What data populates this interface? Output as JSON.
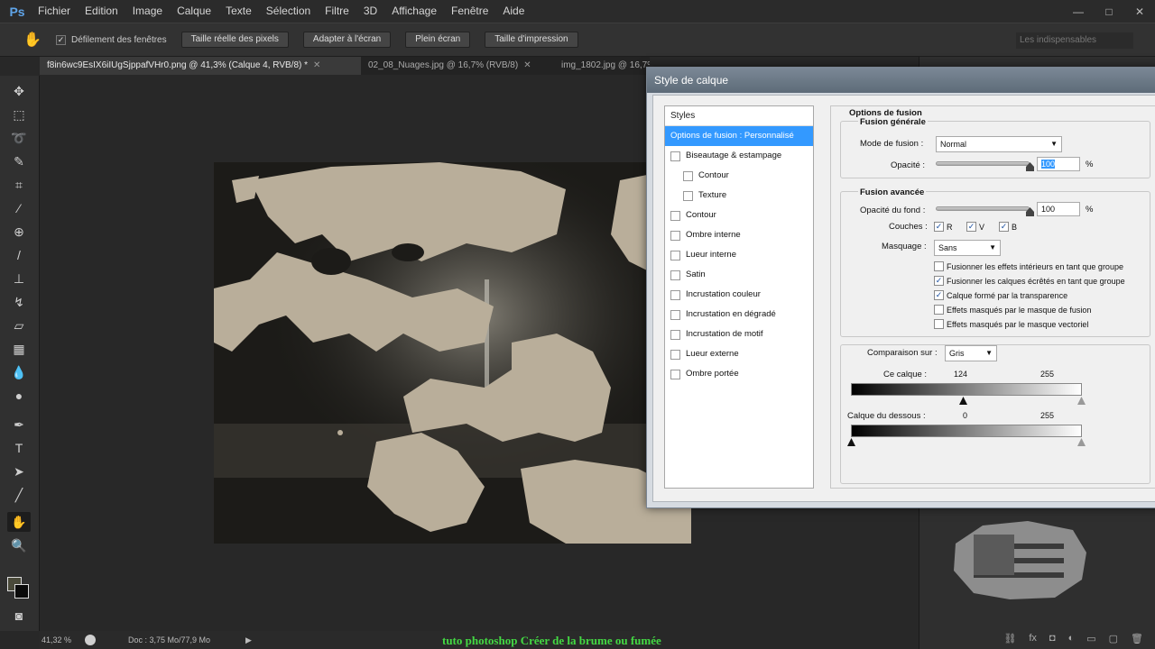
{
  "app": {
    "logo": "Ps"
  },
  "menu": [
    "Fichier",
    "Edition",
    "Image",
    "Calque",
    "Texte",
    "Sélection",
    "Filtre",
    "3D",
    "Affichage",
    "Fenêtre",
    "Aide"
  ],
  "window_controls": {
    "minimize": "—",
    "maximize": "□",
    "close": "✕"
  },
  "options_bar": {
    "scroll_all_label": "Défilement des fenêtres",
    "buttons": [
      "Taille réelle des pixels",
      "Adapter à l'écran",
      "Plein écran",
      "Taille d'impression"
    ],
    "workspace": "Les indispensables"
  },
  "tabs": [
    {
      "label": "f8in6wc9EsIX6iIUgSjppafVHr0.png @ 41,3% (Calque 4, RVB/8) *",
      "active": true
    },
    {
      "label": "02_08_Nuages.jpg @ 16,7% (RVB/8)",
      "active": false
    },
    {
      "label": "img_1802.jpg @ 16,7% (RVB/8)",
      "active": false
    }
  ],
  "tools": [
    "move-icon",
    "marquee-icon",
    "lasso-icon",
    "quick-select-icon",
    "crop-icon",
    "eyedropper-icon",
    "healing-icon",
    "brush-icon",
    "stamp-icon",
    "history-brush-icon",
    "eraser-icon",
    "gradient-icon",
    "blur-icon",
    "dodge-icon",
    "pen-icon",
    "type-icon",
    "path-select-icon",
    "line-icon",
    "hand-icon",
    "zoom-icon"
  ],
  "status": {
    "zoom": "41,32 %",
    "doc": "Doc : 3,75 Mo/77,9 Mo"
  },
  "caption": "tuto photoshop Créer de la brume ou fumée",
  "dialog": {
    "title": "Style de calque",
    "styles_header": "Styles",
    "styles": [
      {
        "label": "Options de fusion : Personnalisé",
        "selected": true,
        "checkbox": false,
        "sub": false
      },
      {
        "label": "Biseautage & estampage",
        "selected": false,
        "checkbox": true,
        "sub": false
      },
      {
        "label": "Contour",
        "selected": false,
        "checkbox": true,
        "sub": true
      },
      {
        "label": "Texture",
        "selected": false,
        "checkbox": true,
        "sub": true
      },
      {
        "label": "Contour",
        "selected": false,
        "checkbox": true,
        "sub": false
      },
      {
        "label": "Ombre interne",
        "selected": false,
        "checkbox": true,
        "sub": false
      },
      {
        "label": "Lueur interne",
        "selected": false,
        "checkbox": true,
        "sub": false
      },
      {
        "label": "Satin",
        "selected": false,
        "checkbox": true,
        "sub": false
      },
      {
        "label": "Incrustation couleur",
        "selected": false,
        "checkbox": true,
        "sub": false
      },
      {
        "label": "Incrustation en dégradé",
        "selected": false,
        "checkbox": true,
        "sub": false
      },
      {
        "label": "Incrustation de motif",
        "selected": false,
        "checkbox": true,
        "sub": false
      },
      {
        "label": "Lueur externe",
        "selected": false,
        "checkbox": true,
        "sub": false
      },
      {
        "label": "Ombre portée",
        "selected": false,
        "checkbox": true,
        "sub": false
      }
    ],
    "options_title": "Options de fusion",
    "general": {
      "title": "Fusion générale",
      "mode_label": "Mode de fusion :",
      "mode_value": "Normal",
      "opacity_label": "Opacité :",
      "opacity_value": "100",
      "opacity_level": 1.0,
      "pct": "%"
    },
    "advanced": {
      "title": "Fusion avancée",
      "fill_label": "Opacité du fond :",
      "fill_value": "100",
      "fill_level": 1.0,
      "channels_label": "Couches :",
      "channels": [
        {
          "label": "R",
          "checked": true
        },
        {
          "label": "V",
          "checked": true
        },
        {
          "label": "B",
          "checked": true
        }
      ],
      "knockout_label": "Masquage :",
      "knockout_value": "Sans",
      "checks": [
        {
          "label": "Fusionner les effets intérieurs en tant que groupe",
          "checked": false
        },
        {
          "label": "Fusionner les calques écrêtés en tant que groupe",
          "checked": true
        },
        {
          "label": "Calque formé par la transparence",
          "checked": true
        },
        {
          "label": "Effets masqués par le masque de fusion",
          "checked": false
        },
        {
          "label": "Effets masqués par le masque vectoriel",
          "checked": false
        }
      ]
    },
    "blend_if": {
      "label": "Comparaison sur :",
      "value": "Gris",
      "this_layer_label": "Ce calque :",
      "this_layer_low": "124",
      "this_layer_high": "255",
      "underlying_label": "Calque du dessous :",
      "underlying_low": "0",
      "underlying_high": "255"
    },
    "check_mark": "✓",
    "dropdown_arrow": "▼"
  },
  "panel_footer_icons": [
    "link-icon",
    "fx-icon",
    "mask-icon",
    "adjustment-icon",
    "folder-icon",
    "new-layer-icon",
    "trash-icon"
  ]
}
